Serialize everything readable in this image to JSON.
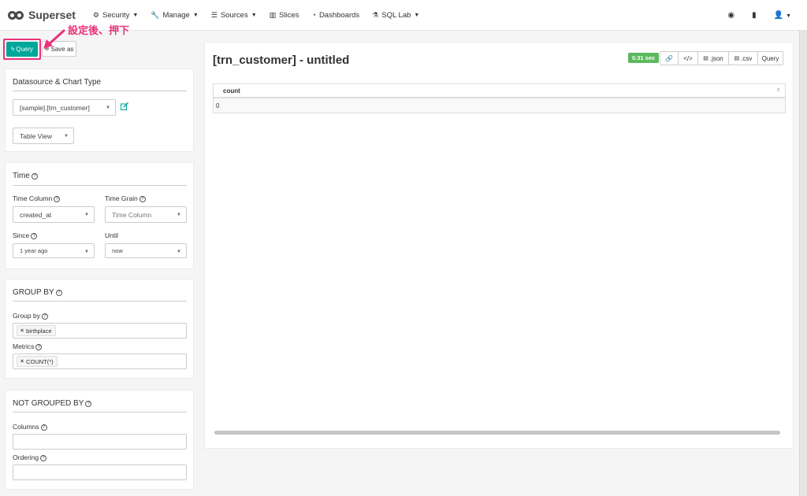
{
  "nav": {
    "brand": "Superset",
    "items": [
      {
        "label": "Security",
        "icon": "cogs-icon",
        "has_caret": true
      },
      {
        "label": "Manage",
        "icon": "wrench-icon",
        "has_caret": true
      },
      {
        "label": "Sources",
        "icon": "database-icon",
        "has_caret": true
      },
      {
        "label": "Slices",
        "icon": "bar-chart-icon",
        "has_caret": false
      },
      {
        "label": "Dashboards",
        "icon": "dashboard-icon",
        "has_caret": false
      },
      {
        "label": "SQL Lab",
        "icon": "flask-icon",
        "has_caret": true
      }
    ],
    "right_icons": [
      "github-icon",
      "book-icon",
      "user-icon"
    ]
  },
  "toolbar": {
    "query_label": "Query",
    "save_as_label": "Save as"
  },
  "annotation": {
    "text": "設定後、押下",
    "color": "#e8337a"
  },
  "datasource_panel": {
    "title": "Datasource & Chart Type",
    "datasource_value": "[sample].[trn_customer]",
    "viz_type_value": "Table View"
  },
  "time_panel": {
    "title": "Time",
    "time_column_label": "Time Column",
    "time_column_value": "created_at",
    "time_grain_label": "Time Grain",
    "time_grain_value": "Time Column",
    "since_label": "Since",
    "since_value": "1 year ago",
    "until_label": "Until",
    "until_value": "now"
  },
  "groupby_panel": {
    "title": "GROUP BY",
    "group_by_label": "Group by",
    "group_by_tags": [
      "birthplace"
    ],
    "metrics_label": "Metrics",
    "metrics_tags": [
      "COUNT(*)"
    ]
  },
  "not_grouped_panel": {
    "title": "NOT GROUPED BY",
    "columns_label": "Columns",
    "ordering_label": "Ordering"
  },
  "chart": {
    "title": "[trn_customer] - untitled",
    "query_time": "0.31 sec",
    "buttons": {
      "json": ".json",
      "csv": ".csv",
      "query": "Query"
    },
    "table": {
      "columns": [
        "count"
      ],
      "rows": [
        [
          "0"
        ]
      ]
    }
  },
  "colors": {
    "primary": "#00a699",
    "success": "#5cb85c",
    "annotation": "#e8337a"
  }
}
